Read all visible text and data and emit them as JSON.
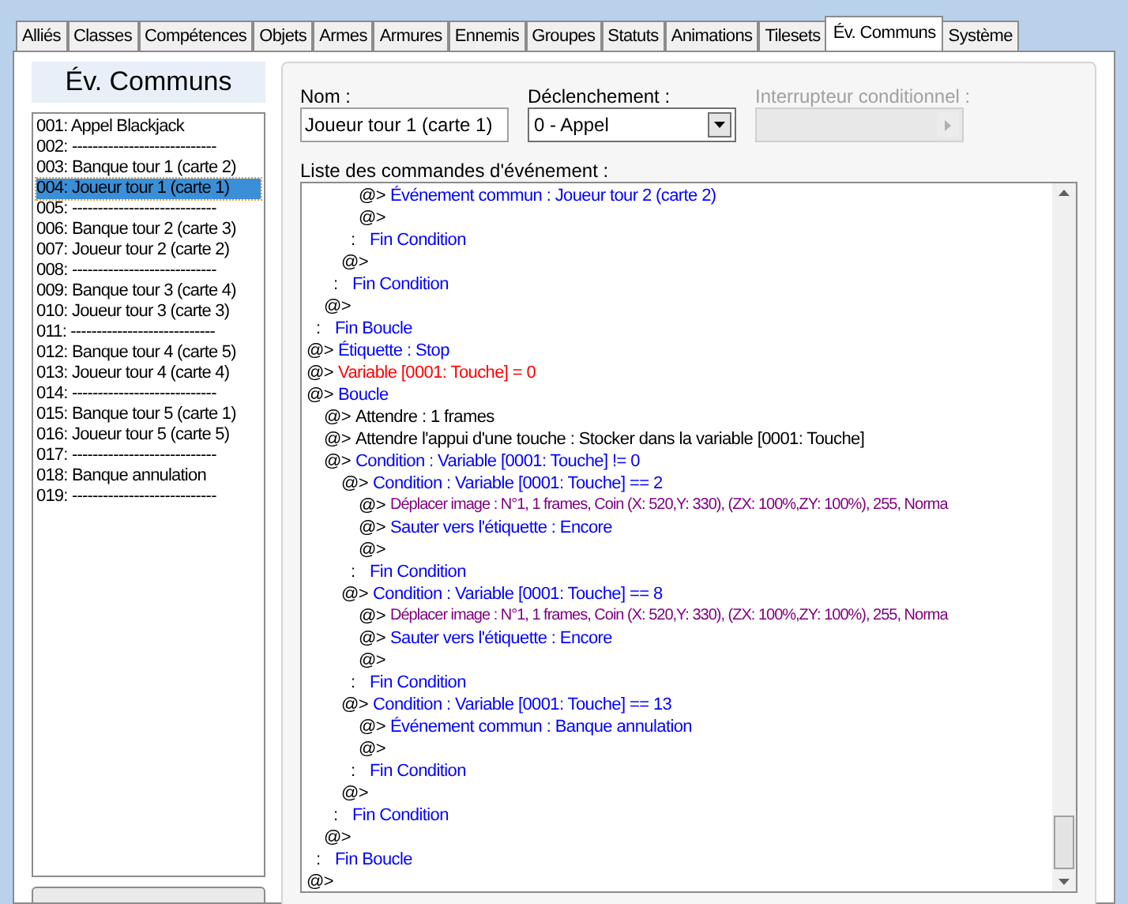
{
  "tabs": [
    {
      "label": "Alliés",
      "selected": false
    },
    {
      "label": "Classes",
      "selected": false
    },
    {
      "label": "Compétences",
      "selected": false
    },
    {
      "label": "Objets",
      "selected": false
    },
    {
      "label": "Armes",
      "selected": false
    },
    {
      "label": "Armures",
      "selected": false
    },
    {
      "label": "Ennemis",
      "selected": false
    },
    {
      "label": "Groupes",
      "selected": false
    },
    {
      "label": "Statuts",
      "selected": false
    },
    {
      "label": "Animations",
      "selected": false
    },
    {
      "label": "Tilesets",
      "selected": false
    },
    {
      "label": "Év. Communs",
      "selected": true
    },
    {
      "label": "Système",
      "selected": false
    }
  ],
  "sidebar": {
    "title": "Év. Communs",
    "items": [
      {
        "label": "001: Appel Blackjack",
        "selected": false
      },
      {
        "label": "002: ----------------------------",
        "selected": false
      },
      {
        "label": "003: Banque tour 1 (carte 2)",
        "selected": false
      },
      {
        "label": "004: Joueur tour 1 (carte 1)",
        "selected": true
      },
      {
        "label": "005: ----------------------------",
        "selected": false
      },
      {
        "label": "006: Banque tour 2 (carte 3)",
        "selected": false
      },
      {
        "label": "007: Joueur tour 2 (carte 2)",
        "selected": false
      },
      {
        "label": "008: ----------------------------",
        "selected": false
      },
      {
        "label": "009: Banque tour 3 (carte 4)",
        "selected": false
      },
      {
        "label": "010: Joueur tour 3 (carte 3)",
        "selected": false
      },
      {
        "label": "011: ----------------------------",
        "selected": false
      },
      {
        "label": "012: Banque tour 4 (carte 5)",
        "selected": false
      },
      {
        "label": "013: Joueur tour 4 (carte 4)",
        "selected": false
      },
      {
        "label": "014: ----------------------------",
        "selected": false
      },
      {
        "label": "015: Banque tour 5 (carte 1)",
        "selected": false
      },
      {
        "label": "016: Joueur tour 5 (carte 5)",
        "selected": false
      },
      {
        "label": "017: ----------------------------",
        "selected": false
      },
      {
        "label": "018: Banque annulation",
        "selected": false
      },
      {
        "label": "019: ----------------------------",
        "selected": false
      }
    ]
  },
  "form": {
    "name_label": "Nom :",
    "name_value": "Joueur tour 1 (carte 1)",
    "trigger_label": "Déclenchement :",
    "trigger_value": "0 - Appel",
    "switch_label": "Interrupteur conditionnel :",
    "switch_disabled": true
  },
  "commands_label": "Liste des commandes d'événement :",
  "commands": [
    {
      "children": [
        {
          "children": [
            {
              "children": [
                {
                  "marker": "@>",
                  "text": "Événement commun : Joueur tour 2 (carte 2)",
                  "kind": "flow"
                },
                {
                  "marker": "@>"
                }
              ]
            },
            {
              "marker": ":",
              "text": "Fin Condition",
              "kind": "flow"
            },
            {
              "marker": "@>"
            }
          ]
        },
        {
          "marker": ":",
          "text": "Fin Condition",
          "kind": "flow"
        },
        {
          "marker": "@>"
        }
      ]
    },
    {
      "marker": ":",
      "text": "Fin Boucle",
      "kind": "flow"
    },
    {
      "marker": "@>",
      "text": "Étiquette : Stop",
      "kind": "flow"
    },
    {
      "marker": "@>",
      "text": "Variable [0001: Touche] = 0",
      "kind": "variable"
    },
    {
      "marker": "@>",
      "text": "Boucle",
      "kind": "flow",
      "children": [
        {
          "marker": "@>",
          "text": "Attendre : 1 frames",
          "kind": "plain"
        },
        {
          "marker": "@>",
          "text": "Attendre l'appui d'une touche : Stocker dans la variable [0001: Touche]",
          "kind": "plain"
        },
        {
          "marker": "@>",
          "text": "Condition : Variable [0001: Touche] != 0",
          "kind": "flow",
          "children": [
            {
              "marker": "@>",
              "text": "Condition : Variable [0001: Touche] == 2",
              "kind": "flow",
              "children": [
                {
                  "marker": "@>",
                  "text": "Déplacer image : N°1, 1 frames, Coin (X: 520,Y: 330), (ZX: 100%,ZY: 100%), 255, Norma",
                  "kind": "picture"
                },
                {
                  "marker": "@>",
                  "text": "Sauter vers l'étiquette : Encore",
                  "kind": "flow"
                },
                {
                  "marker": "@>"
                }
              ]
            },
            {
              "marker": ":",
              "text": "Fin Condition",
              "kind": "flow"
            },
            {
              "marker": "@>",
              "text": "Condition : Variable [0001: Touche] == 8",
              "kind": "flow",
              "children": [
                {
                  "marker": "@>",
                  "text": "Déplacer image : N°1, 1 frames, Coin (X: 520,Y: 330), (ZX: 100%,ZY: 100%), 255, Norma",
                  "kind": "picture"
                },
                {
                  "marker": "@>",
                  "text": "Sauter vers l'étiquette : Encore",
                  "kind": "flow"
                },
                {
                  "marker": "@>"
                }
              ]
            },
            {
              "marker": ":",
              "text": "Fin Condition",
              "kind": "flow"
            },
            {
              "marker": "@>",
              "text": "Condition : Variable [0001: Touche] == 13",
              "kind": "flow",
              "children": [
                {
                  "marker": "@>",
                  "text": "Événement commun : Banque annulation",
                  "kind": "flow"
                },
                {
                  "marker": "@>"
                }
              ]
            },
            {
              "marker": ":",
              "text": "Fin Condition",
              "kind": "flow"
            },
            {
              "marker": "@>"
            }
          ]
        },
        {
          "marker": ":",
          "text": "Fin Condition",
          "kind": "flow"
        },
        {
          "marker": "@>"
        }
      ]
    },
    {
      "marker": ":",
      "text": "Fin Boucle",
      "kind": "flow"
    },
    {
      "marker": "@>"
    }
  ]
}
